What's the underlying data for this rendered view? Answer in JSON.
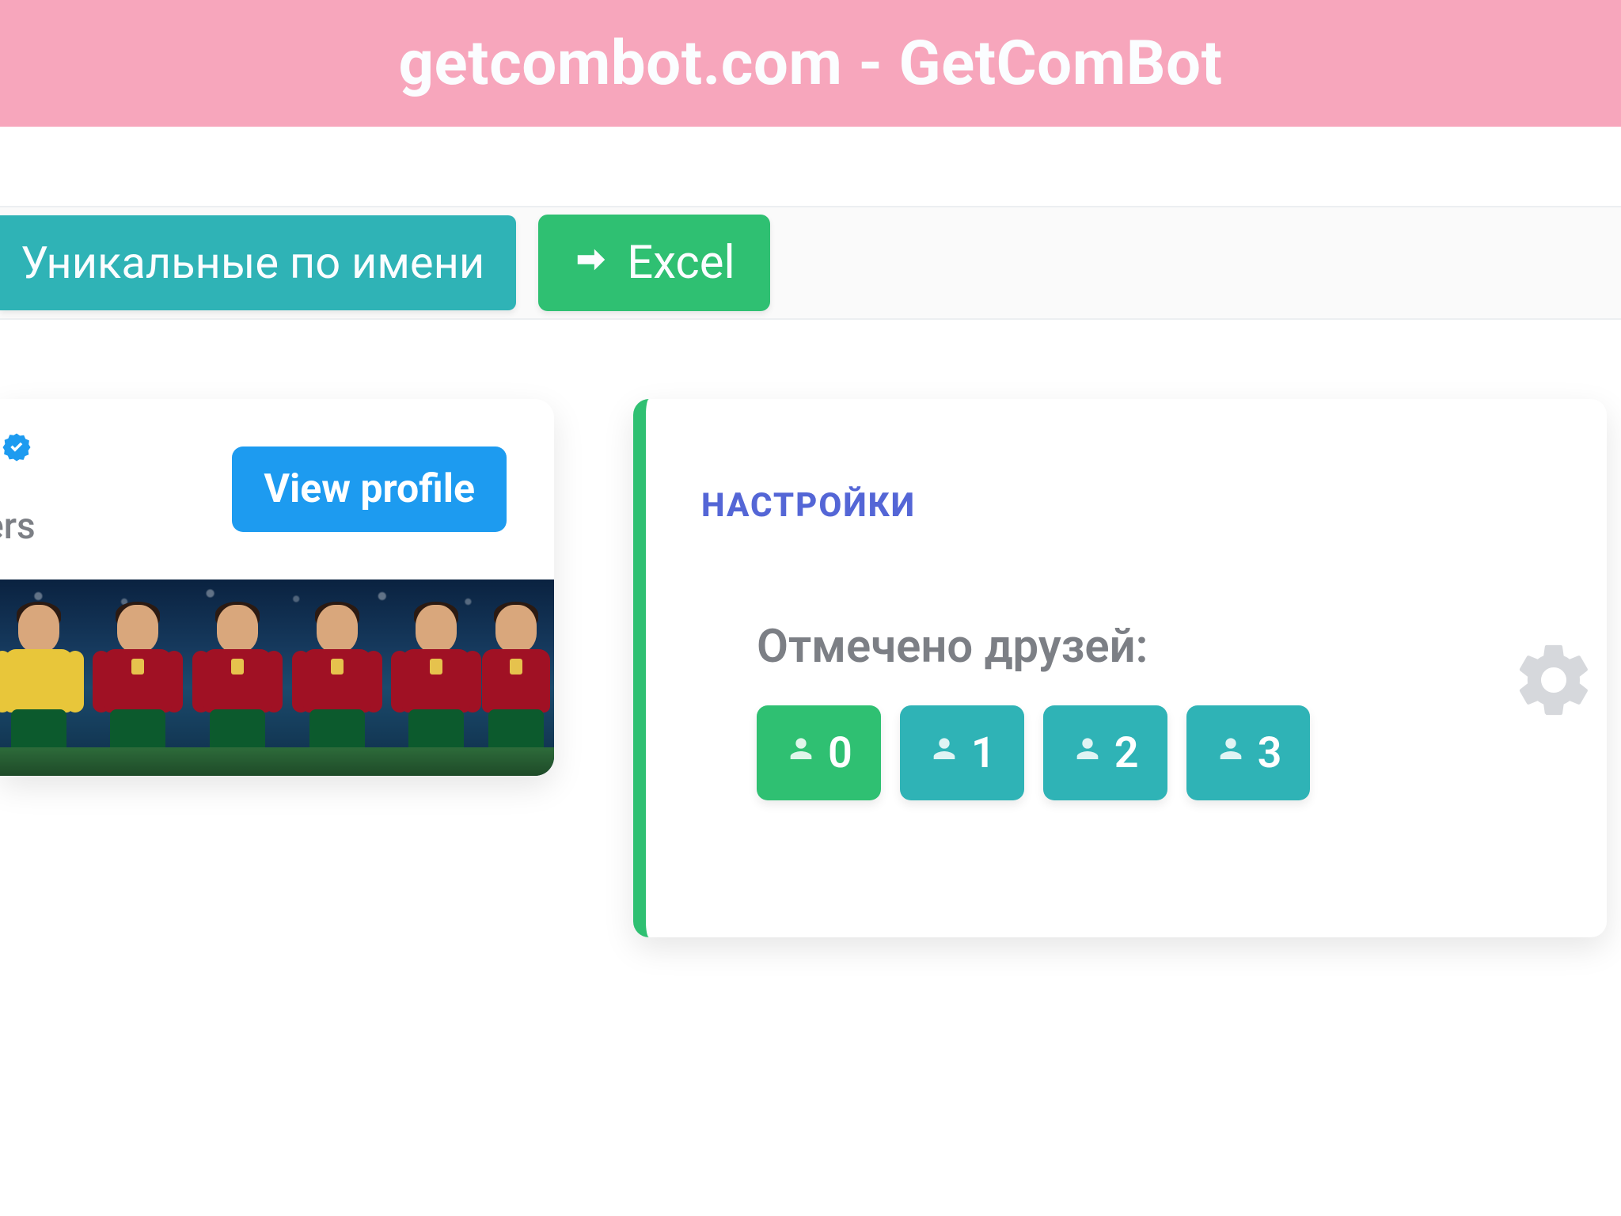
{
  "header": {
    "title": "getcombot.com - GetComBot"
  },
  "toolbar": {
    "unique_label": "Уникальные по имени",
    "excel_label": "Excel"
  },
  "profile": {
    "followers_fragment": "wers",
    "view_profile_label": "View profile"
  },
  "settings": {
    "title": "НАСТРОЙКИ",
    "friends_label": "Отмечено друзей:",
    "friend_counts": [
      "0",
      "1",
      "2",
      "3"
    ]
  },
  "colors": {
    "banner": "#f7a6bc",
    "teal": "#2fb3b6",
    "green": "#2fc072",
    "blue": "#1d9bf0",
    "indigo": "#5466d6"
  }
}
